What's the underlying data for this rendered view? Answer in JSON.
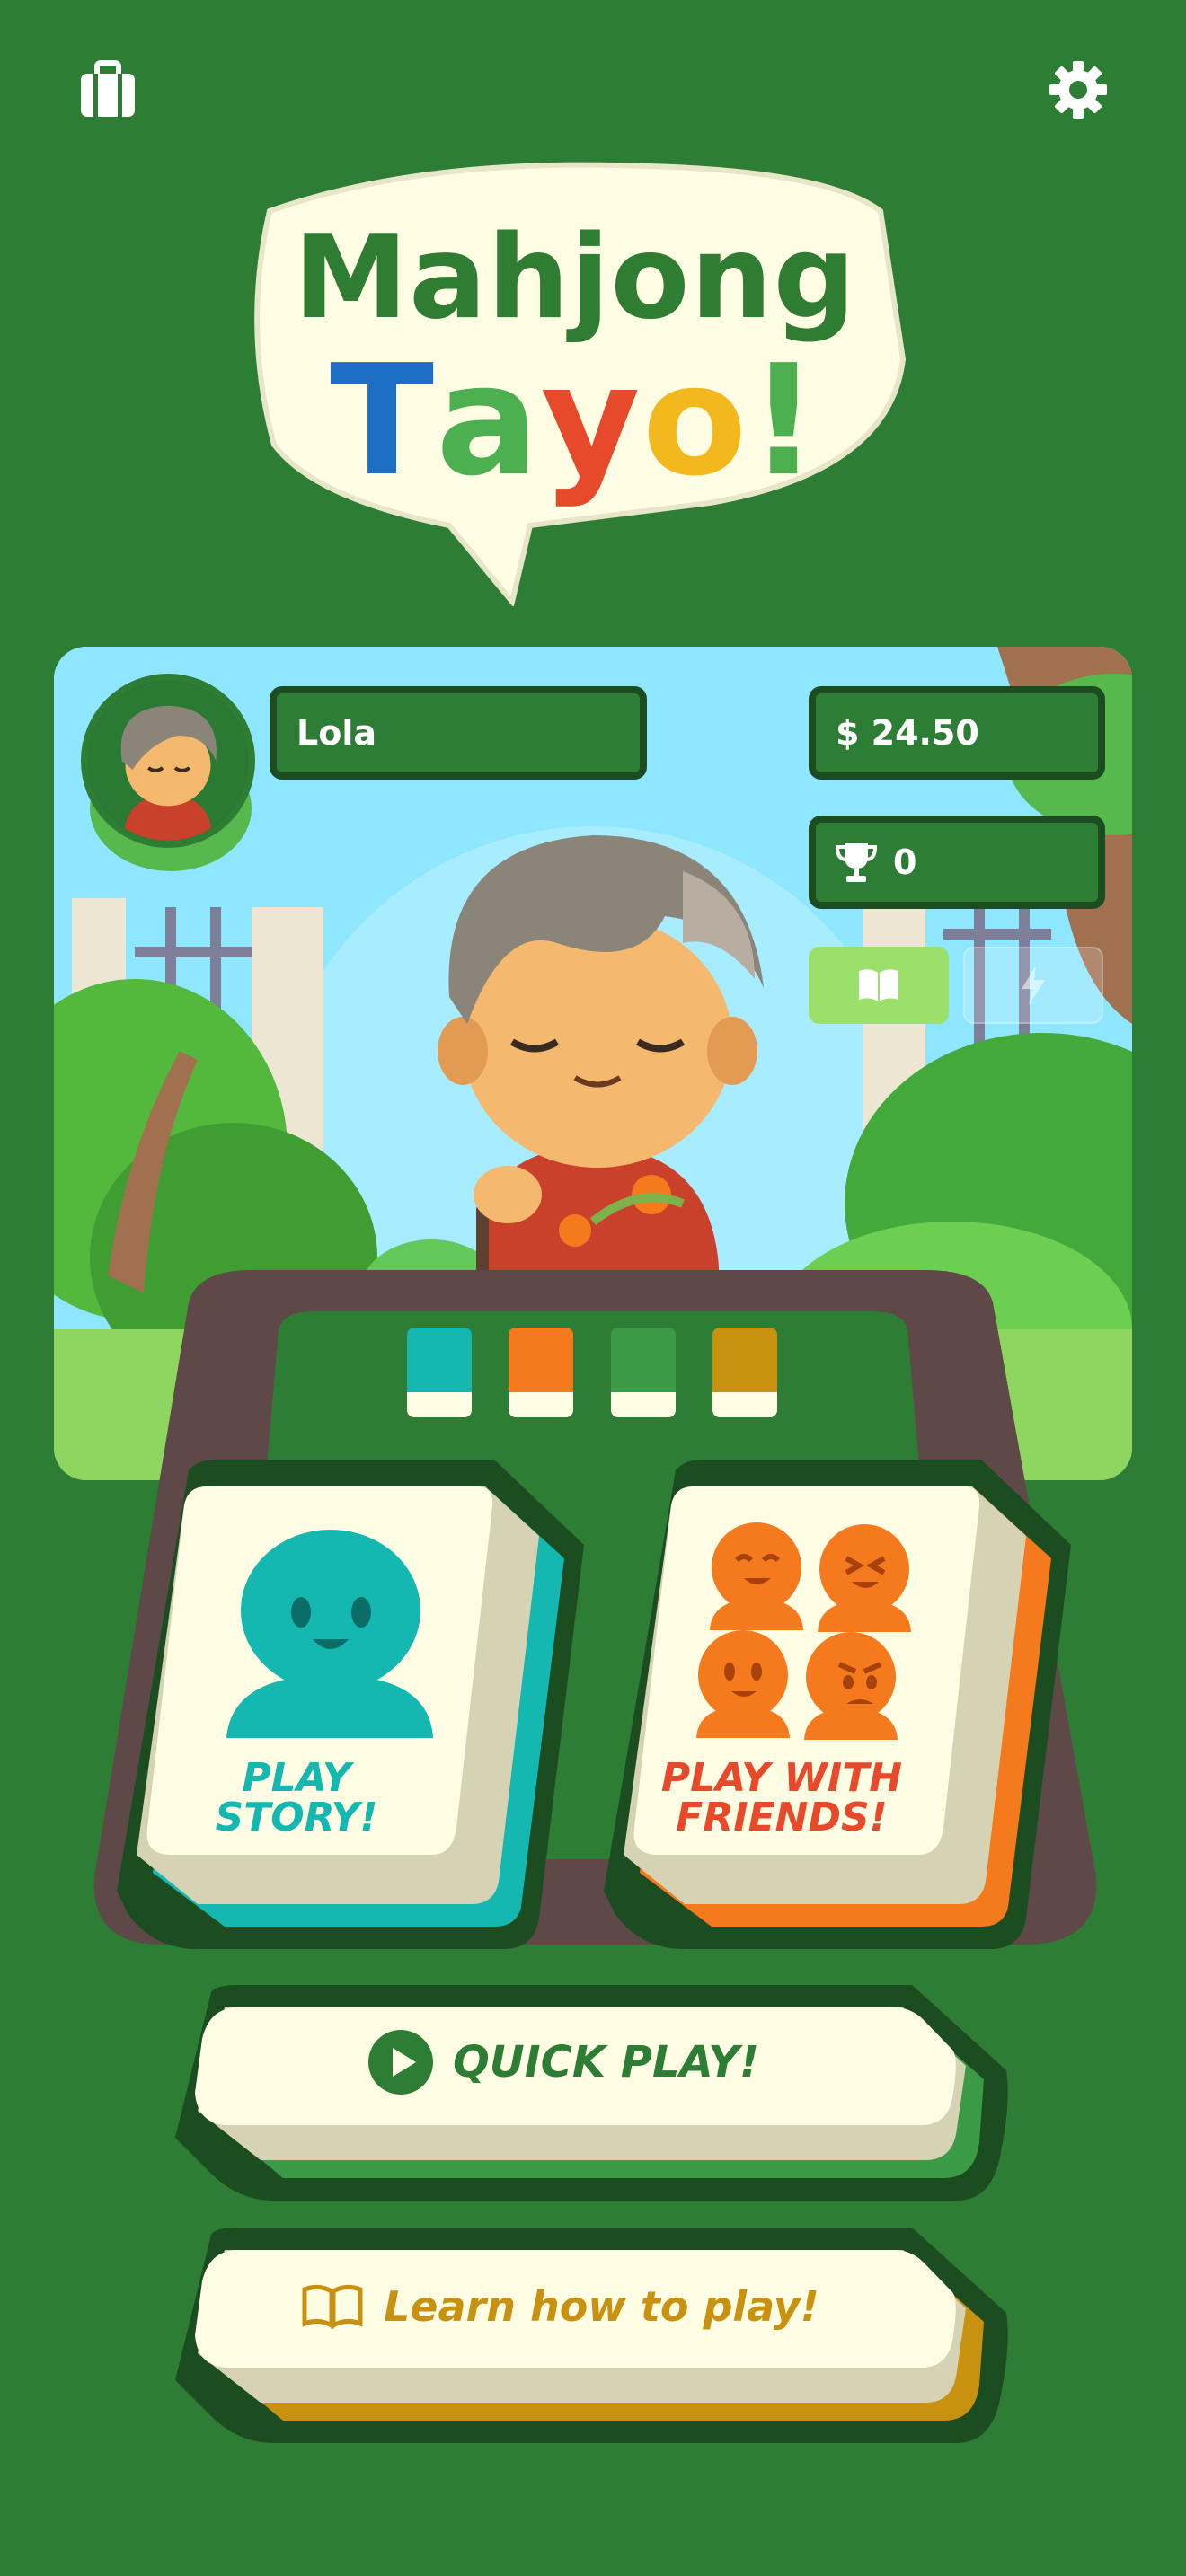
{
  "app": {
    "logo_line1": "Mahjong",
    "logo_line2": [
      "T",
      "a",
      "y",
      "o",
      "!"
    ]
  },
  "header": {
    "left_icon": "briefcase-icon",
    "right_icon": "gear-icon"
  },
  "player": {
    "name": "Lola",
    "money": "$ 24.50",
    "trophies": "0",
    "book_button_icon": "book-icon",
    "bolt_button_icon": "lightning-icon"
  },
  "tile_colors": [
    "#14b8b0",
    "#f57a1e",
    "#3a9a45",
    "#c89210"
  ],
  "menu": {
    "story_label_1": "PLAY",
    "story_label_2": "STORY!",
    "friends_label_1": "PLAY WITH",
    "friends_label_2": "FRIENDS!",
    "quick_play": "QUICK PLAY!",
    "learn": "Learn how to play!"
  },
  "colors": {
    "background": "#2e7d35",
    "dark_green": "#1b4d21",
    "teal": "#14b8b0",
    "orange": "#f57a1e",
    "gold": "#c89210",
    "cream": "#fffde4"
  }
}
